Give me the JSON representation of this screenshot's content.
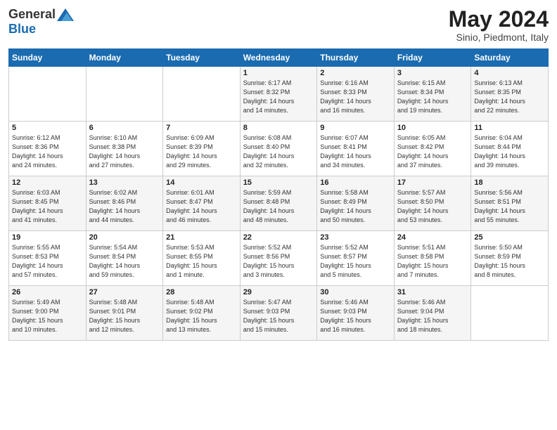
{
  "header": {
    "logo": {
      "general": "General",
      "blue": "Blue"
    },
    "title": "May 2024",
    "location": "Sinio, Piedmont, Italy"
  },
  "days_of_week": [
    "Sunday",
    "Monday",
    "Tuesday",
    "Wednesday",
    "Thursday",
    "Friday",
    "Saturday"
  ],
  "weeks": [
    [
      {
        "day": "",
        "info": ""
      },
      {
        "day": "",
        "info": ""
      },
      {
        "day": "",
        "info": ""
      },
      {
        "day": "1",
        "info": "Sunrise: 6:17 AM\nSunset: 8:32 PM\nDaylight: 14 hours\nand 14 minutes."
      },
      {
        "day": "2",
        "info": "Sunrise: 6:16 AM\nSunset: 8:33 PM\nDaylight: 14 hours\nand 16 minutes."
      },
      {
        "day": "3",
        "info": "Sunrise: 6:15 AM\nSunset: 8:34 PM\nDaylight: 14 hours\nand 19 minutes."
      },
      {
        "day": "4",
        "info": "Sunrise: 6:13 AM\nSunset: 8:35 PM\nDaylight: 14 hours\nand 22 minutes."
      }
    ],
    [
      {
        "day": "5",
        "info": "Sunrise: 6:12 AM\nSunset: 8:36 PM\nDaylight: 14 hours\nand 24 minutes."
      },
      {
        "day": "6",
        "info": "Sunrise: 6:10 AM\nSunset: 8:38 PM\nDaylight: 14 hours\nand 27 minutes."
      },
      {
        "day": "7",
        "info": "Sunrise: 6:09 AM\nSunset: 8:39 PM\nDaylight: 14 hours\nand 29 minutes."
      },
      {
        "day": "8",
        "info": "Sunrise: 6:08 AM\nSunset: 8:40 PM\nDaylight: 14 hours\nand 32 minutes."
      },
      {
        "day": "9",
        "info": "Sunrise: 6:07 AM\nSunset: 8:41 PM\nDaylight: 14 hours\nand 34 minutes."
      },
      {
        "day": "10",
        "info": "Sunrise: 6:05 AM\nSunset: 8:42 PM\nDaylight: 14 hours\nand 37 minutes."
      },
      {
        "day": "11",
        "info": "Sunrise: 6:04 AM\nSunset: 8:44 PM\nDaylight: 14 hours\nand 39 minutes."
      }
    ],
    [
      {
        "day": "12",
        "info": "Sunrise: 6:03 AM\nSunset: 8:45 PM\nDaylight: 14 hours\nand 41 minutes."
      },
      {
        "day": "13",
        "info": "Sunrise: 6:02 AM\nSunset: 8:46 PM\nDaylight: 14 hours\nand 44 minutes."
      },
      {
        "day": "14",
        "info": "Sunrise: 6:01 AM\nSunset: 8:47 PM\nDaylight: 14 hours\nand 46 minutes."
      },
      {
        "day": "15",
        "info": "Sunrise: 5:59 AM\nSunset: 8:48 PM\nDaylight: 14 hours\nand 48 minutes."
      },
      {
        "day": "16",
        "info": "Sunrise: 5:58 AM\nSunset: 8:49 PM\nDaylight: 14 hours\nand 50 minutes."
      },
      {
        "day": "17",
        "info": "Sunrise: 5:57 AM\nSunset: 8:50 PM\nDaylight: 14 hours\nand 53 minutes."
      },
      {
        "day": "18",
        "info": "Sunrise: 5:56 AM\nSunset: 8:51 PM\nDaylight: 14 hours\nand 55 minutes."
      }
    ],
    [
      {
        "day": "19",
        "info": "Sunrise: 5:55 AM\nSunset: 8:53 PM\nDaylight: 14 hours\nand 57 minutes."
      },
      {
        "day": "20",
        "info": "Sunrise: 5:54 AM\nSunset: 8:54 PM\nDaylight: 14 hours\nand 59 minutes."
      },
      {
        "day": "21",
        "info": "Sunrise: 5:53 AM\nSunset: 8:55 PM\nDaylight: 15 hours\nand 1 minute."
      },
      {
        "day": "22",
        "info": "Sunrise: 5:52 AM\nSunset: 8:56 PM\nDaylight: 15 hours\nand 3 minutes."
      },
      {
        "day": "23",
        "info": "Sunrise: 5:52 AM\nSunset: 8:57 PM\nDaylight: 15 hours\nand 5 minutes."
      },
      {
        "day": "24",
        "info": "Sunrise: 5:51 AM\nSunset: 8:58 PM\nDaylight: 15 hours\nand 7 minutes."
      },
      {
        "day": "25",
        "info": "Sunrise: 5:50 AM\nSunset: 8:59 PM\nDaylight: 15 hours\nand 8 minutes."
      }
    ],
    [
      {
        "day": "26",
        "info": "Sunrise: 5:49 AM\nSunset: 9:00 PM\nDaylight: 15 hours\nand 10 minutes."
      },
      {
        "day": "27",
        "info": "Sunrise: 5:48 AM\nSunset: 9:01 PM\nDaylight: 15 hours\nand 12 minutes."
      },
      {
        "day": "28",
        "info": "Sunrise: 5:48 AM\nSunset: 9:02 PM\nDaylight: 15 hours\nand 13 minutes."
      },
      {
        "day": "29",
        "info": "Sunrise: 5:47 AM\nSunset: 9:03 PM\nDaylight: 15 hours\nand 15 minutes."
      },
      {
        "day": "30",
        "info": "Sunrise: 5:46 AM\nSunset: 9:03 PM\nDaylight: 15 hours\nand 16 minutes."
      },
      {
        "day": "31",
        "info": "Sunrise: 5:46 AM\nSunset: 9:04 PM\nDaylight: 15 hours\nand 18 minutes."
      },
      {
        "day": "",
        "info": ""
      }
    ]
  ]
}
